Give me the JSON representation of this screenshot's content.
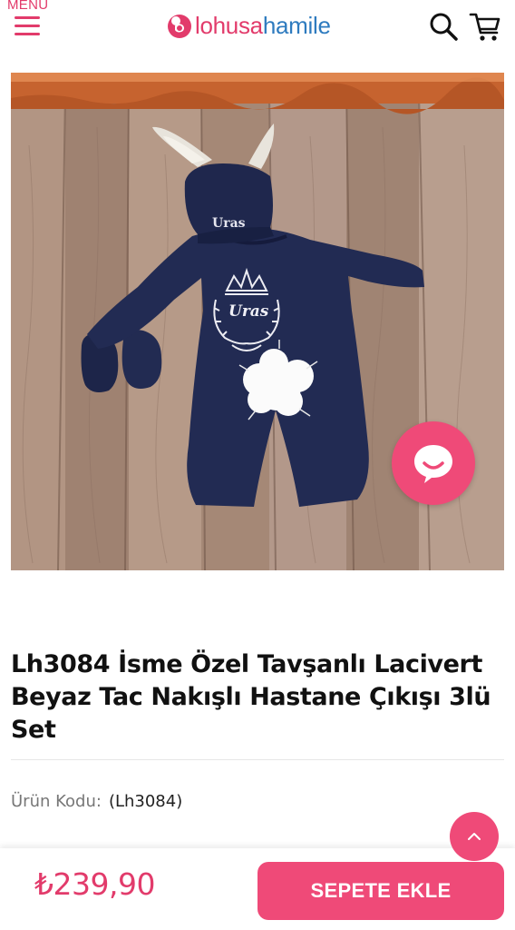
{
  "header": {
    "menu_label": "MENU",
    "logo_part1": "lohusa",
    "logo_part2": "hamile"
  },
  "product": {
    "image_alt": "Lacivert tavşanlı bebek tulum seti, Uras nakışlı",
    "image_embroidery_text": "Uras",
    "title": "Lh3084 İsme Özel Tavşanlı Lacivert Beyaz Tac Nakışlı Hastane Çıkışı 3lü Set",
    "code_label": "Ürün Kodu:",
    "code_value": "(Lh3084)",
    "price": "₺239,90"
  },
  "actions": {
    "add_to_cart": "SEPETE EKLE"
  },
  "colors": {
    "accent": "#ef4a78",
    "brand_pink": "#e23b6b",
    "brand_blue": "#2e7bbf"
  },
  "icons": {
    "menu": "hamburger-icon",
    "search": "search-icon",
    "cart": "cart-icon",
    "chat": "chat-icon",
    "scroll_top": "chevron-up-icon"
  }
}
